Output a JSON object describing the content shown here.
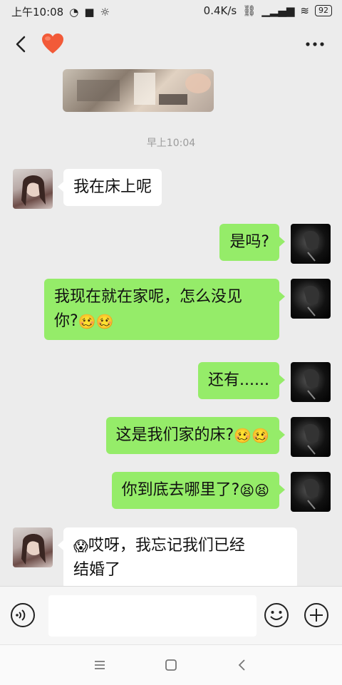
{
  "status_bar": {
    "time": "上午10:08",
    "network_speed": "0.4K/s",
    "battery": "92"
  },
  "chat": {
    "timestamp": "早上10:04",
    "messages": [
      {
        "side": "left",
        "text": "我在床上呢"
      },
      {
        "side": "right",
        "text": "是吗?"
      },
      {
        "side": "right",
        "line1": "我现在就在家呢，怎么没见",
        "line2": "你?",
        "emoji": "🥴🥴"
      },
      {
        "side": "right",
        "text": "还有......"
      },
      {
        "side": "right",
        "text": "这是我们家的床?",
        "emoji": "🥴🥴"
      },
      {
        "side": "right",
        "text": "你到底去哪里了?",
        "emoji": "😫😫"
      },
      {
        "side": "left",
        "emoji_prefix": "😱",
        "line1": "哎呀，我忘记我们已经",
        "line2": "结婚了"
      }
    ]
  },
  "icons": {
    "back": "chevron-left-icon",
    "heart": "heart-icon",
    "more": "more-icon",
    "voice": "voice-icon",
    "emoji": "emoji-icon",
    "plus": "plus-icon"
  },
  "colors": {
    "background": "#ececec",
    "bubble_green": "#95ec69",
    "bubble_white": "#ffffff",
    "heart": "#f25a38",
    "timestamp": "#9b9b9b"
  }
}
